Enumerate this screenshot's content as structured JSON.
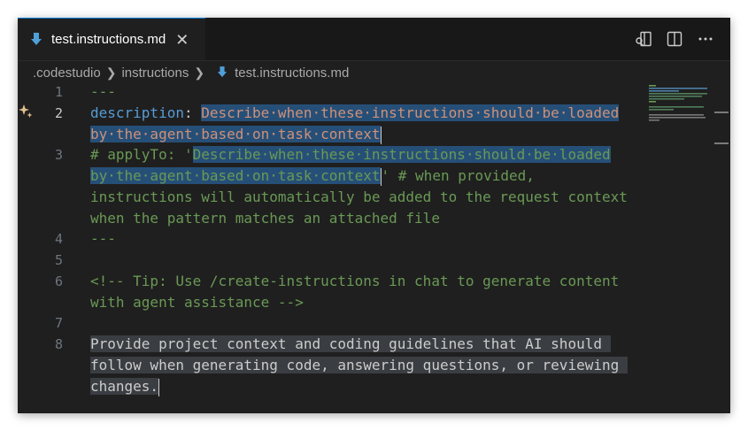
{
  "tab": {
    "label": "test.instructions.md",
    "close": "✕"
  },
  "breadcrumb": {
    "items": [
      ".codestudio",
      "instructions",
      "test.instructions.md"
    ]
  },
  "editor": {
    "line_numbers": [
      "1",
      "2",
      "3",
      "4",
      "5",
      "6",
      "7",
      "8"
    ],
    "lines": {
      "l1": "---",
      "l2_key": "description",
      "l2_colon": ": ",
      "l2_val_a": "Describe·when·these·instructions·should·be·loaded",
      "l2_val_b": "by·the·agent·based·on·task·context",
      "l3_prefix": "# applyTo: '",
      "l3_sel_a": "Describe·when·these·instructions·should·be·loaded",
      "l3_sel_b": "by·the·agent·based·on·task·context",
      "l3_suffix": "' # when provided,",
      "l3_c": "instructions will automatically be added to the request context",
      "l3_d": "when the pattern matches an attached file",
      "l4": "---",
      "l6_a": "<!-- Tip: Use /create-instructions in chat to generate content",
      "l6_b": "with agent assistance -->",
      "l8_a": "Provide project context and coding guidelines that AI should ",
      "l8_b": "follow when generating code, answering questions, or reviewing ",
      "l8_c": "changes."
    }
  },
  "colors": {
    "keyword": "#569cd6",
    "comment": "#6a9955",
    "selection": "#264f78",
    "accent": "#0078d4"
  },
  "icons": {
    "file": "markdown-down-arrow-icon",
    "sparkle": "sparkle-icon",
    "open-preview": "open-preview-icon",
    "split": "split-editor-icon",
    "more": "more-actions-icon"
  }
}
